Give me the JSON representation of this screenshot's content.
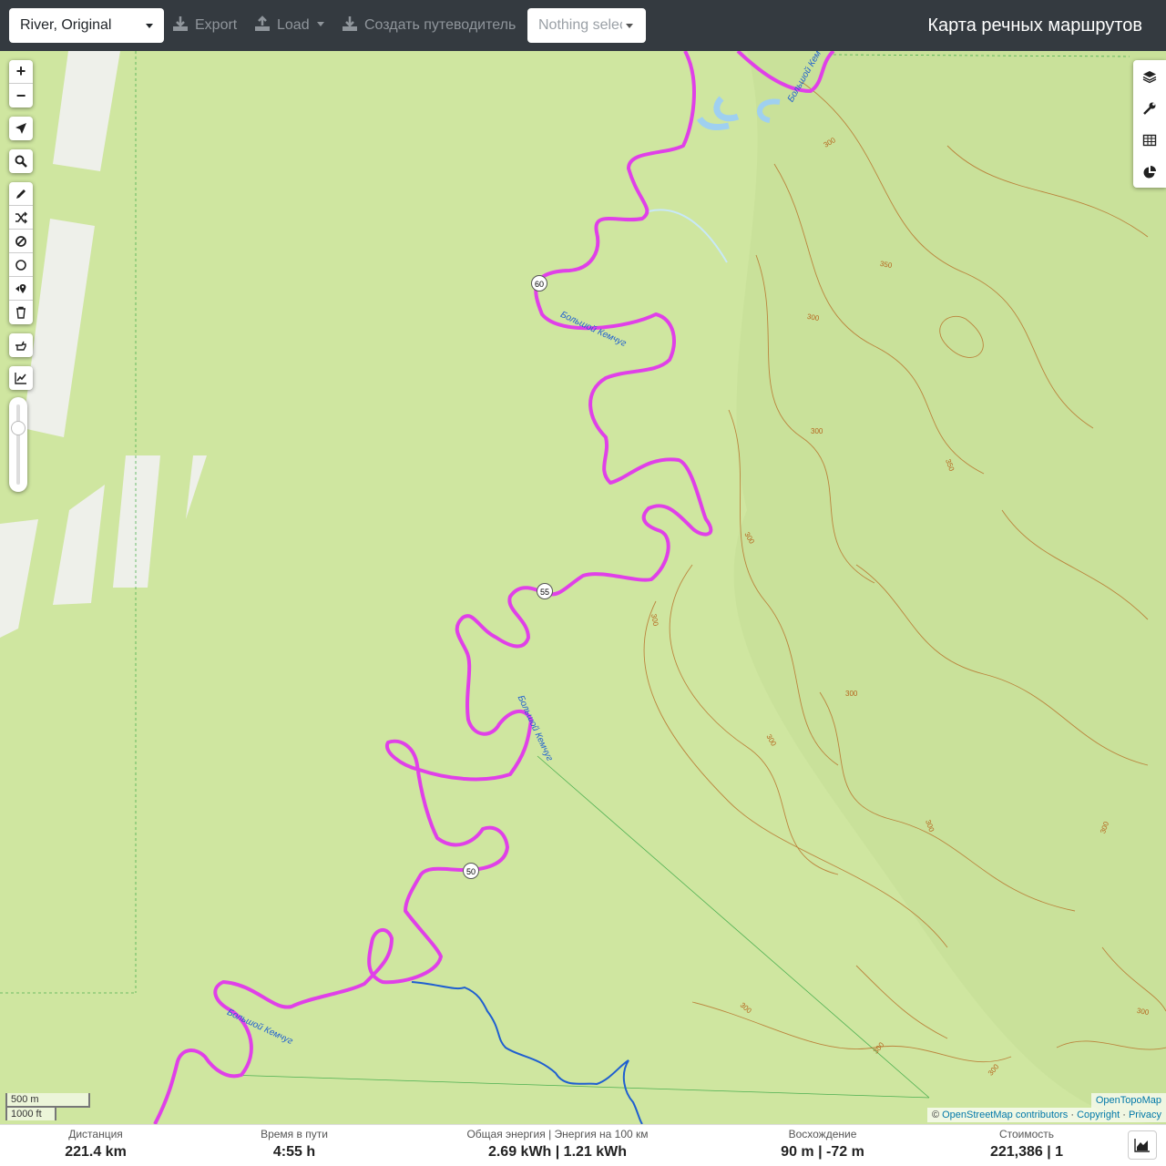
{
  "header": {
    "profile_select": "River, Original",
    "export_label": "Export",
    "load_label": "Load",
    "guide_label": "Создать путеводитель",
    "route_select_placeholder": "Nothing selected",
    "app_title": "Карта речных маршрутов"
  },
  "map": {
    "zoom_in": "+",
    "zoom_out": "−",
    "km_markers": [
      "60",
      "55",
      "50"
    ],
    "river_labels": [
      "Большой Кемчуг",
      "Большой Кемчуг",
      "Большой Кемчуг",
      "Большой Кемчуг"
    ],
    "contour_labels": [
      "300",
      "350",
      "300",
      "300",
      "350",
      "300",
      "300",
      "300",
      "300",
      "300",
      "300",
      "300",
      "300",
      "300",
      "300"
    ],
    "scale_metric": "500 m",
    "scale_imperial": "1000 ft",
    "attribution_tiles": "OpenTopoMap",
    "attribution_prefix": "© ",
    "attribution_osm": "OpenStreetMap contributors",
    "attribution_sep1": " · ",
    "attribution_copyright": "Copyright",
    "attribution_sep2": " · ",
    "attribution_privacy": "Privacy",
    "colors": {
      "route": "#e040e8",
      "river": "#1f5fd0",
      "land": "#cfe6a0",
      "contour": "#b5651d"
    }
  },
  "stats": {
    "distance_label": "Дистанция",
    "distance_value": "221.4 km",
    "time_label": "Время в пути",
    "time_value": "4:55 h",
    "energy_label": "Общая энергия | Энергия на 100 км",
    "energy_value": "2.69 kWh | 1.21 kWh",
    "ascent_label": "Восхождение",
    "ascent_value": "90 m | -72 m",
    "cost_label": "Стоимость",
    "cost_value": "221,386 | 1"
  }
}
